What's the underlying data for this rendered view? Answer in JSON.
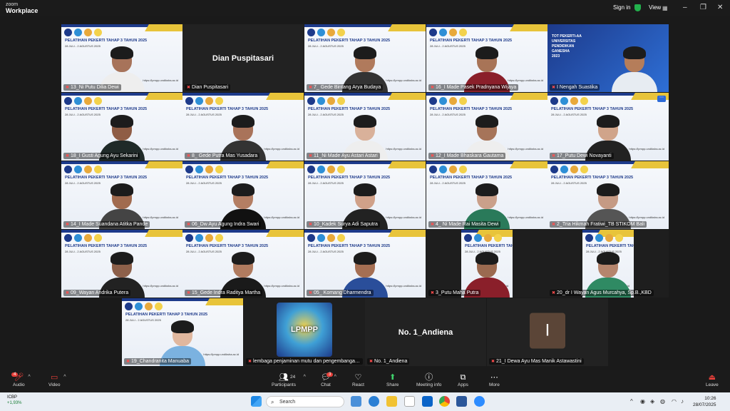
{
  "app": {
    "brand_line1": "zoom",
    "brand_line2": "Workplace",
    "signin": "Sign in",
    "view": "View"
  },
  "tiles": [
    {
      "name": "13_Ni Putu Dilia Dewi",
      "kind": "slide",
      "selected": true,
      "skin": "#a7735a",
      "shirt": "#eee"
    },
    {
      "name": "Dian Puspitasari",
      "kind": "dark",
      "big": "Dian Puspitasari"
    },
    {
      "name": "7_ Gede Bintang Arya Budaya",
      "kind": "slide",
      "skin": "#b07a5c",
      "shirt": "#333"
    },
    {
      "name": "16_I Made Pasek Pradnyana Wijaya",
      "kind": "slide",
      "skin": "#a87457",
      "shirt": "#8a1f2a"
    },
    {
      "name": "I Nengah Suastika",
      "kind": "blue",
      "skin": "#b57d5a",
      "shirt": "#e7ecf2"
    },
    {
      "name": "18_I Gusti Agung Ayu Sekarini",
      "kind": "slide",
      "skin": "#8f5d45",
      "shirt": "#1f2a28"
    },
    {
      "name": "8_ Gede Putra Mas Yusadara",
      "kind": "slide",
      "skin": "#a9735a",
      "shirt": "#333"
    },
    {
      "name": "11_Ni Made Ayu Astari Astari",
      "kind": "slide",
      "skin": "#d9b19a",
      "shirt": "#eee"
    },
    {
      "name": "12_I Made Bhaskara Gautama",
      "kind": "slide",
      "skin": "#a67459",
      "shirt": "#eee"
    },
    {
      "name": "17_Putu Dewi Novayanti",
      "kind": "slide",
      "skin": "#d0a48a",
      "shirt": "#222"
    },
    {
      "name": "14_I Made Suandana Atitka Pande",
      "kind": "slide",
      "skin": "#a16b4f",
      "shirt": "#444"
    },
    {
      "name": "06_Dw Ayu Agung Indra Swari",
      "kind": "slide",
      "skin": "#b47e63",
      "shirt": "#111"
    },
    {
      "name": "10_Kadek Surya Adi Saputra",
      "kind": "slide",
      "skin": "#d0a189",
      "shirt": "#222"
    },
    {
      "name": "4_ Ni Made Rai Masita Dewi",
      "kind": "slide",
      "skin": "#caa08a",
      "shirt": "#2a7a5a"
    },
    {
      "name": "2_Tria Hikmah Fratiwi_TB STIKOM Bali",
      "kind": "slide",
      "skin": "#c59a84",
      "shirt": "#555"
    },
    {
      "name": "09_Wayan Andrika Putera",
      "kind": "slide",
      "skin": "#8d604a",
      "shirt": "#222"
    },
    {
      "name": "15_Gede Indra Raditya Martha",
      "kind": "slide",
      "skin": "#b07b5f",
      "shirt": "#1a1a1a"
    },
    {
      "name": "05_ Komang Dharmendra",
      "kind": "slide",
      "skin": "#a56f53",
      "shirt": "#2a4e9a"
    },
    {
      "name": "3_Putu Maha Putra",
      "kind": "slidebox",
      "skin": "#9b6a50",
      "shirt": "#8a1f2a"
    },
    {
      "name": "20_dr I Wayan Agus Murcahya, Sp.B.,KBD",
      "kind": "slidebox",
      "skin": "#b5856d",
      "shirt": "#2f8a63"
    }
  ],
  "bottom_tiles": [
    {
      "name": "19_Chandranita Manuaba",
      "kind": "slide",
      "skin": "#e0b79e",
      "shirt": "#7bb2e0"
    },
    {
      "name": "lembaga penjaminan mutu dan pengembangan ...",
      "kind": "lpmpp",
      "logo_text": "LPMPP"
    },
    {
      "name": "No. 1_Andiena",
      "kind": "dark",
      "big": "No. 1_Andiena"
    },
    {
      "name": "21_I Dewa Ayu Mas Manik Astawastini",
      "kind": "avatar",
      "initial": "I"
    }
  ],
  "slide": {
    "title": "PELATIHAN PEKERTI TAHAP 3 TAHUN 2025",
    "dates": "28 JULI - 2 AGUSTUS 2025",
    "url": "https://lpmpp.undiksha.ac.id"
  },
  "blue_slide": {
    "line1": "TOT PEKERTI-AA",
    "line2": "UNIVERSITAS",
    "line3": "PENDIDIKAN",
    "line4": "GANESHA",
    "line5": "2023"
  },
  "toolbar": {
    "audio": "Audio",
    "video": "Video",
    "participants": "Participants",
    "participants_count": "24",
    "chat": "Chat",
    "chat_badge": "3",
    "react": "React",
    "share": "Share",
    "meeting_info": "Meeting info",
    "apps": "Apps",
    "more": "More",
    "leave": "Leave",
    "audio_badge": "4"
  },
  "taskbar": {
    "stock_name": "ICBP",
    "stock_change": "+1,93%",
    "search_placeholder": "Search",
    "time": "10:26",
    "date": "28/07/2025"
  }
}
